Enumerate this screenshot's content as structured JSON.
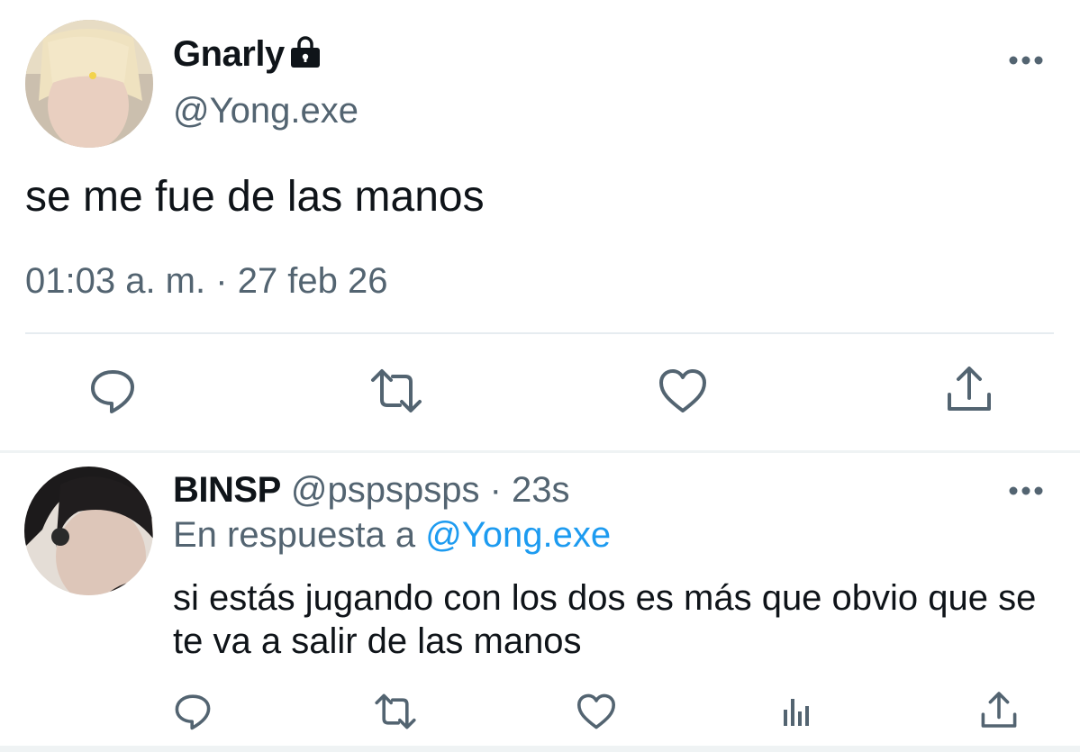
{
  "tweet": {
    "display_name": "Gnarly",
    "handle": "@Yong.exe",
    "text": "se me fue de las manos",
    "time": "01:03 a. m.",
    "separator": "·",
    "date": "27 feb 26",
    "protected_icon": "lock-icon",
    "actions": [
      "reply-icon",
      "retweet-icon",
      "like-icon",
      "share-icon"
    ]
  },
  "reply": {
    "display_name": "BINSP",
    "handle": "@pspspsps",
    "separator": "·",
    "age": "23s",
    "in_reply_prefix": "En respuesta a",
    "in_reply_handle": "@Yong.exe",
    "text": "si estás jugando con los dos es más que obvio que se te va a salir de las manos",
    "actions": [
      "reply-icon",
      "retweet-icon",
      "like-icon",
      "analytics-icon",
      "share-icon"
    ]
  },
  "colors": {
    "text": "#0f1419",
    "secondary": "#536471",
    "link": "#1d9bf0",
    "divider": "#e6ecf0"
  }
}
